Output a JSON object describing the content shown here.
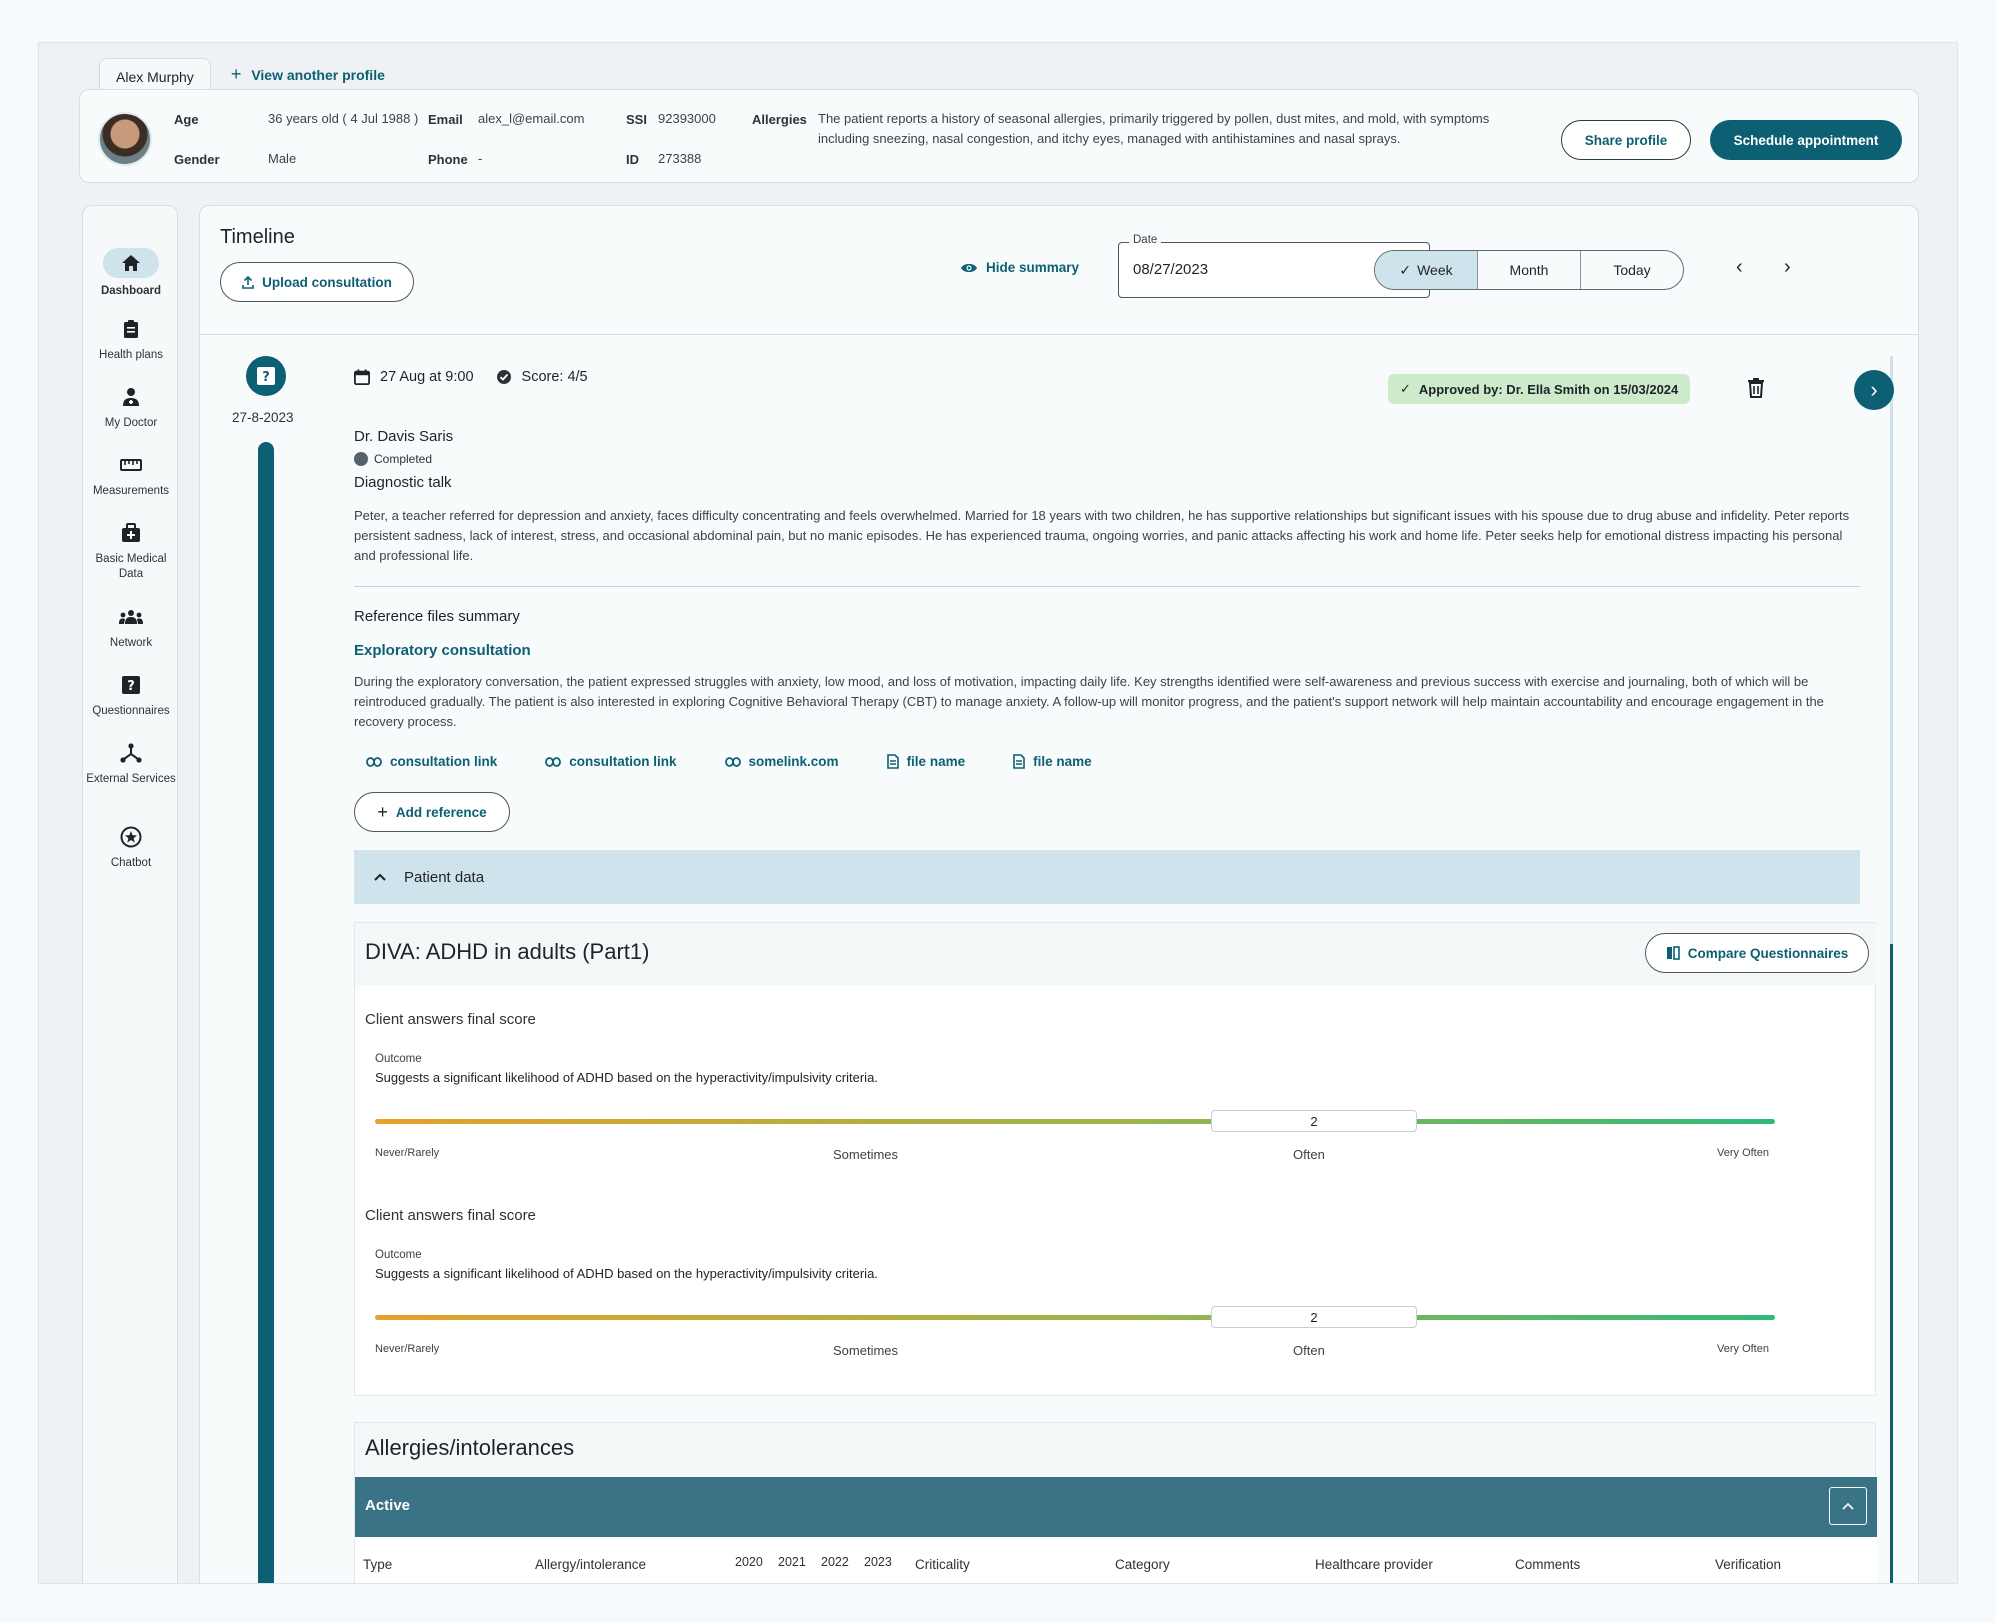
{
  "tabs": {
    "active": "Alex Murphy",
    "add_label": "View another profile"
  },
  "profile": {
    "age_label": "Age",
    "age_value": "36 years old ( 4 Jul 1988 )",
    "gender_label": "Gender",
    "gender_value": "Male",
    "email_label": "Email",
    "email_value": "alex_l@email.com",
    "phone_label": "Phone",
    "phone_value": "-",
    "ssi_label": "SSI",
    "ssi_value": "92393000",
    "id_label": "ID",
    "id_value": "273388",
    "allergies_label": "Allergies",
    "allergies_value": "The patient reports a history of seasonal allergies, primarily triggered by pollen, dust mites, and mold, with symptoms including sneezing, nasal congestion, and itchy eyes, managed with antihistamines and nasal sprays.",
    "share_label": "Share profile",
    "schedule_label": "Schedule appointment"
  },
  "sidebar": {
    "items": [
      {
        "label": "Dashboard",
        "icon": "home-icon"
      },
      {
        "label": "Health plans",
        "icon": "clipboard-icon"
      },
      {
        "label": "My Doctor",
        "icon": "doctor-icon"
      },
      {
        "label": "Measurements",
        "icon": "ruler-icon"
      },
      {
        "label": "Basic Medical Data",
        "icon": "medical-bag-icon"
      },
      {
        "label": "Network",
        "icon": "network-icon"
      },
      {
        "label": "Questionnaires",
        "icon": "question-icon"
      },
      {
        "label": "External Services",
        "icon": "hub-icon"
      },
      {
        "label": "Chatbot",
        "icon": "chatbot-icon"
      }
    ]
  },
  "timeline": {
    "title": "Timeline",
    "upload_label": "Upload consultation",
    "hide_summary_label": "Hide summary",
    "date_label": "Date",
    "date_value": "08/27/2023",
    "views": [
      "Week",
      "Month",
      "Today"
    ],
    "active_view": "Week"
  },
  "entry": {
    "date": "27-8-2023",
    "datetime": "27 Aug at 9:00",
    "score": "Score: 4/5",
    "approved": "Approved by: Dr. Ella Smith on 15/03/2024",
    "doctor": "Dr. Davis Saris",
    "status": "Completed",
    "type": "Diagnostic talk",
    "description": "Peter, a teacher referred for depression and anxiety, faces difficulty concentrating and feels overwhelmed. Married for 18 years with two children, he has supportive relationships but significant issues with his spouse due to drug abuse and infidelity. Peter reports persistent sadness, lack of interest, stress, and occasional abdominal pain, but no manic episodes. He has experienced trauma, ongoing worries, and panic attacks affecting his work and home life. Peter seeks help for emotional distress impacting his personal and professional life.",
    "ref_summary_title": "Reference files summary",
    "exploratory_title": "Exploratory consultation",
    "exploratory_text": "During the exploratory conversation, the patient expressed struggles with anxiety, low mood, and loss of motivation, impacting daily life. Key strengths identified were self-awareness and previous success with exercise and journaling, both of which will be reintroduced gradually. The patient is also interested in exploring Cognitive Behavioral Therapy (CBT) to manage anxiety. A follow-up will monitor progress, and the patient's support network will help maintain accountability and encourage engagement in the recovery process.",
    "references": [
      {
        "label": "consultation link",
        "icon": "link-icon"
      },
      {
        "label": "consultation link",
        "icon": "link-icon"
      },
      {
        "label": "somelink.com",
        "icon": "link-icon"
      },
      {
        "label": "file name",
        "icon": "file-icon"
      },
      {
        "label": "file name",
        "icon": "file-icon"
      }
    ],
    "add_reference_label": "Add reference",
    "patient_data_label": "Patient data"
  },
  "diva": {
    "title": "DIVA: ADHD in adults (Part1)",
    "compare_label": "Compare Questionnaires",
    "scores": [
      {
        "title": "Client answers final score",
        "outcome_label": "Outcome",
        "outcome": "Suggests a significant likelihood of ADHD based on the hyperactivity/impulsivity criteria.",
        "value": "2"
      },
      {
        "title": "Client answers final score",
        "outcome_label": "Outcome",
        "outcome": "Suggests a significant likelihood of ADHD based on the hyperactivity/impulsivity criteria.",
        "value": "2"
      }
    ],
    "scale": {
      "min": "Never/Rarely",
      "mid1": "Sometimes",
      "mid2": "Often",
      "max": "Very Often"
    }
  },
  "allergies": {
    "title": "Allergies/intolerances",
    "active_label": "Active",
    "columns": [
      "Type",
      "Allergy/intolerance",
      "Criticality",
      "Category",
      "Healthcare provider",
      "Comments",
      "Verification"
    ],
    "years": [
      "2020",
      "2021",
      "2022",
      "2023"
    ]
  },
  "colors": {
    "accent": "#0d5f73",
    "approved_bg": "#cdeacb",
    "active_bar": "#3a7385"
  }
}
